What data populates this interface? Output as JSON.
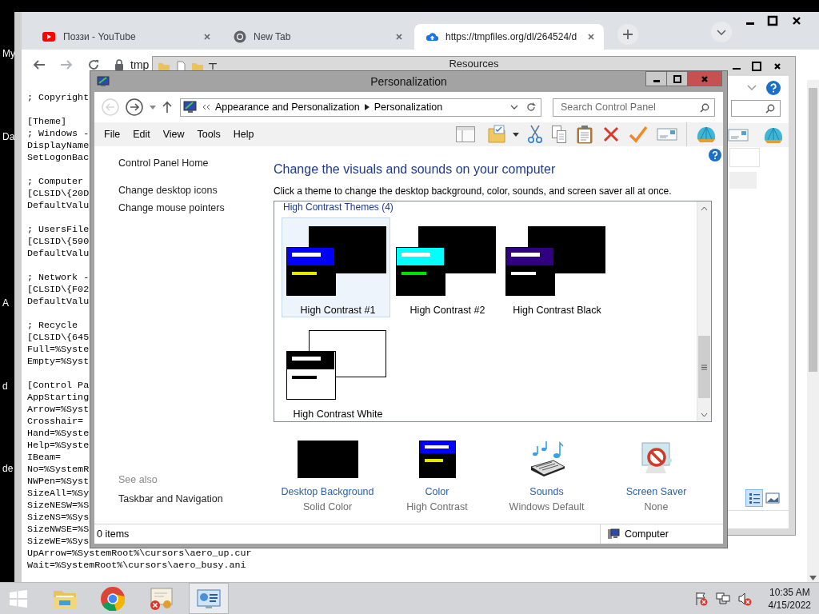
{
  "desktop_icons": [
    {
      "label": "My"
    },
    {
      "label": "Da"
    },
    {
      "label": "A"
    },
    {
      "label": "d"
    },
    {
      "label": "de"
    }
  ],
  "browser": {
    "tabs": [
      {
        "kind": "video",
        "title": "Поззи - YouTube",
        "selected": false
      },
      {
        "kind": "newtab",
        "title": "New Tab",
        "selected": false
      },
      {
        "kind": "upload",
        "title": "https://tmpfiles.org/dl/264524/d",
        "selected": true
      }
    ],
    "address": "tmp",
    "text_blocks": [
      [
        "; Copyright"
      ],
      [
        "[Theme]",
        "; Windows -",
        "DisplayName",
        "SetLogonBac"
      ],
      [
        "; Computer",
        "[CLSID\\{20D",
        "DefaultValu"
      ],
      [
        "; UsersFile",
        "[CLSID\\{590",
        "DefaultValu"
      ],
      [
        "; Network -",
        "[CLSID\\{F02",
        "DefaultValu"
      ],
      [
        "; Recycle",
        "[CLSID\\{645",
        "Full=%Syste",
        "Empty=%Syst"
      ],
      [
        "[Control Pa",
        "AppStarting",
        "Arrow=%Syst",
        "Crosshair=",
        "Hand=%Syste",
        "Help=%Syste",
        "IBeam=",
        "No=%SystemR",
        "NWPen=%Syst",
        "SizeAll=%Sy",
        "SizeNESW=%S",
        "SizeNS=%Sys",
        "SizeNWSE=%S",
        "SizeWE=%Sys",
        "UpArrow=%SystemRoot%\\cursors\\aero_up.cur",
        "Wait=%SystemRoot%\\cursors\\aero_busy.ani"
      ]
    ]
  },
  "resources": {
    "title": "Resources"
  },
  "personalization": {
    "title": "Personalization",
    "breadcrumb": [
      "Appearance and Personalization",
      "Personalization"
    ],
    "search": {
      "placeholder": "Search Control Panel"
    },
    "menu": [
      "File",
      "Edit",
      "View",
      "Tools",
      "Help"
    ],
    "home_link": "Control Panel Home",
    "tasks": [
      "Change desktop icons",
      "Change mouse pointers"
    ],
    "see_also": {
      "heading": "See also",
      "links": [
        "Taskbar and Navigation"
      ]
    },
    "heading": "Change the visuals and sounds on your computer",
    "description": "Click a theme to change the desktop background, color, sounds, and screen saver all at once.",
    "theme_group": "High Contrast Themes (4)",
    "themes": [
      {
        "kind": "hc1",
        "name": "High Contrast #1",
        "selected": true
      },
      {
        "kind": "hc2",
        "name": "High Contrast #2",
        "selected": false
      },
      {
        "kind": "black",
        "name": "High Contrast Black",
        "selected": false
      },
      {
        "kind": "white",
        "name": "High Contrast White",
        "selected": false
      }
    ],
    "settings": [
      {
        "kind": "background",
        "label": "Desktop Background",
        "value": "Solid Color"
      },
      {
        "kind": "color",
        "label": "Color",
        "value": "High Contrast"
      },
      {
        "kind": "sounds",
        "label": "Sounds",
        "value": "Windows Default"
      },
      {
        "kind": "screensaver",
        "label": "Screen Saver",
        "value": "None"
      }
    ],
    "status_count": "0 items",
    "status_location": "Computer"
  },
  "taskbar": {
    "apps": [
      {
        "kind": "explorer",
        "selected": false
      },
      {
        "kind": "chrome",
        "selected": false
      },
      {
        "kind": "certificate",
        "selected": false
      },
      {
        "kind": "control-panel",
        "selected": true
      }
    ],
    "time": "10:35 AM",
    "date": "4/15/2022"
  }
}
